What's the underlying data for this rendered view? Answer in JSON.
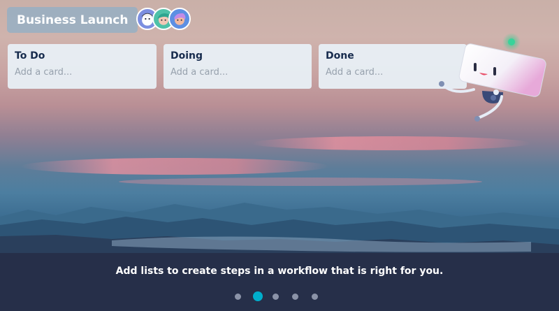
{
  "board": {
    "title": "Business Launch"
  },
  "members": [
    {
      "name": "member-1",
      "color": "#6b7fd7"
    },
    {
      "name": "member-2",
      "color": "#3fb3a0"
    },
    {
      "name": "member-3",
      "color": "#5c8fe0"
    }
  ],
  "lists": [
    {
      "title": "To Do",
      "add_placeholder": "Add a card..."
    },
    {
      "title": "Doing",
      "add_placeholder": "Add a card..."
    },
    {
      "title": "Done",
      "add_placeholder": "Add a card..."
    }
  ],
  "caption": "Add lists to create steps in a workflow that is right for you.",
  "pagination": {
    "total": 5,
    "current": 2
  },
  "colors": {
    "accent": "#00aecc",
    "list_bg": "#e8eff5",
    "bar_bg": "#262e48"
  }
}
